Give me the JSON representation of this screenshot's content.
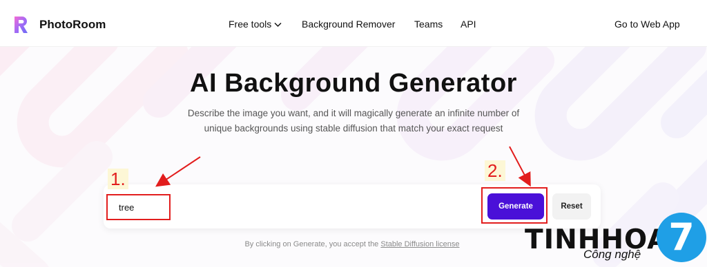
{
  "brand": {
    "name": "PhotoRoom",
    "accent": "#4a10d8"
  },
  "nav": {
    "free_tools": "Free tools",
    "background_remover": "Background Remover",
    "teams": "Teams",
    "api": "API",
    "go_to_web_app": "Go to Web App"
  },
  "hero": {
    "title": "AI Background Generator",
    "description": "Describe the image you want, and it will magically generate an infinite number of unique backgrounds using stable diffusion that match your exact request"
  },
  "prompt": {
    "value": "tree"
  },
  "buttons": {
    "generate": "Generate",
    "reset": "Reset"
  },
  "terms": {
    "prefix": "By clicking on Generate, you accept the ",
    "link": "Stable Diffusion license"
  },
  "annotations": {
    "step1": "1.",
    "step2": "2.",
    "color": "#e21d1d"
  },
  "watermark": {
    "main": "TINHHOA",
    "sub": "Công nghệ",
    "badge": "7"
  }
}
